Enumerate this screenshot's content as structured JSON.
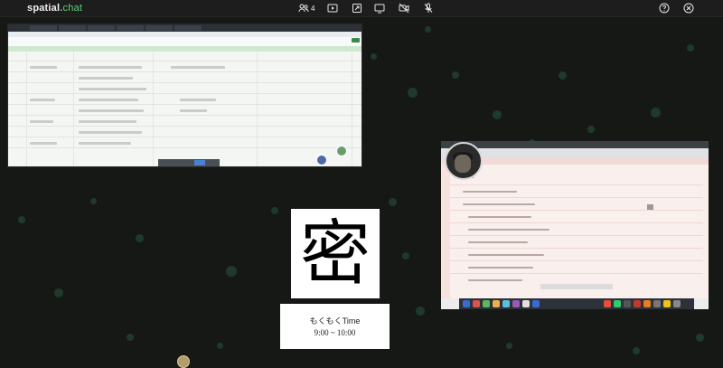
{
  "app": {
    "logo_main": "spatial",
    "logo_dot": ".",
    "logo_accent": "chat"
  },
  "topbar": {
    "participants_icon": "people-icon",
    "participants_count": "4",
    "icons": [
      "people-icon",
      "play-icon",
      "share-icon",
      "screen-share-icon",
      "camera-off-icon",
      "mic-off-icon",
      "help-icon",
      "exit-icon"
    ]
  },
  "room": {
    "sign_character": "密",
    "event_title": "もくもくTime",
    "event_time": "9:00 ~ 10:00"
  },
  "colors": {
    "background": "#161816",
    "accent": "#5fd07a",
    "dots": "#1f3a2a"
  }
}
